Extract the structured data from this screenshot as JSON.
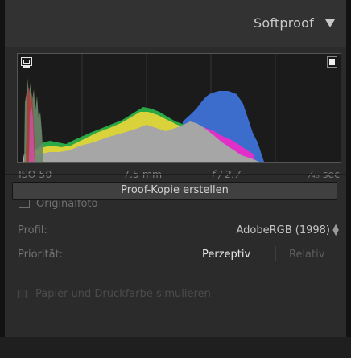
{
  "panel": {
    "title": "Softproof"
  },
  "exif": {
    "iso": "ISO 50",
    "focal_length": "7.5 mm",
    "aperture": "f / 2.7",
    "shutter": "¹⁄₄₅ sec"
  },
  "original": {
    "label": "Originalfoto"
  },
  "proof_button": {
    "label": "Proof-Kopie erstellen"
  },
  "settings": {
    "profile_label": "Profil:",
    "profile_value": "AdobeRGB (1998)",
    "priority_label": "Priorität:",
    "priority_options": [
      "Perzeptiv",
      "Relativ"
    ],
    "priority_selected": "Perzeptiv"
  },
  "simulate": {
    "label": "Papier und Druckfarbe simulieren",
    "checked": false
  },
  "icons": {
    "collapse": "triangle-down-icon",
    "shadow_clip": "monitor-clip-icon",
    "highlight_clip": "document-clip-icon"
  },
  "colors": {
    "panel_bg": "#2b2b2b",
    "header_bg": "#323232",
    "hist_gray": "#a6a6a6",
    "hist_yellow": "#d9d23a",
    "hist_green": "#2aa845",
    "hist_blue": "#3c6ccc",
    "hist_magenta": "#e030c8",
    "hist_red": "#c02a2a"
  }
}
